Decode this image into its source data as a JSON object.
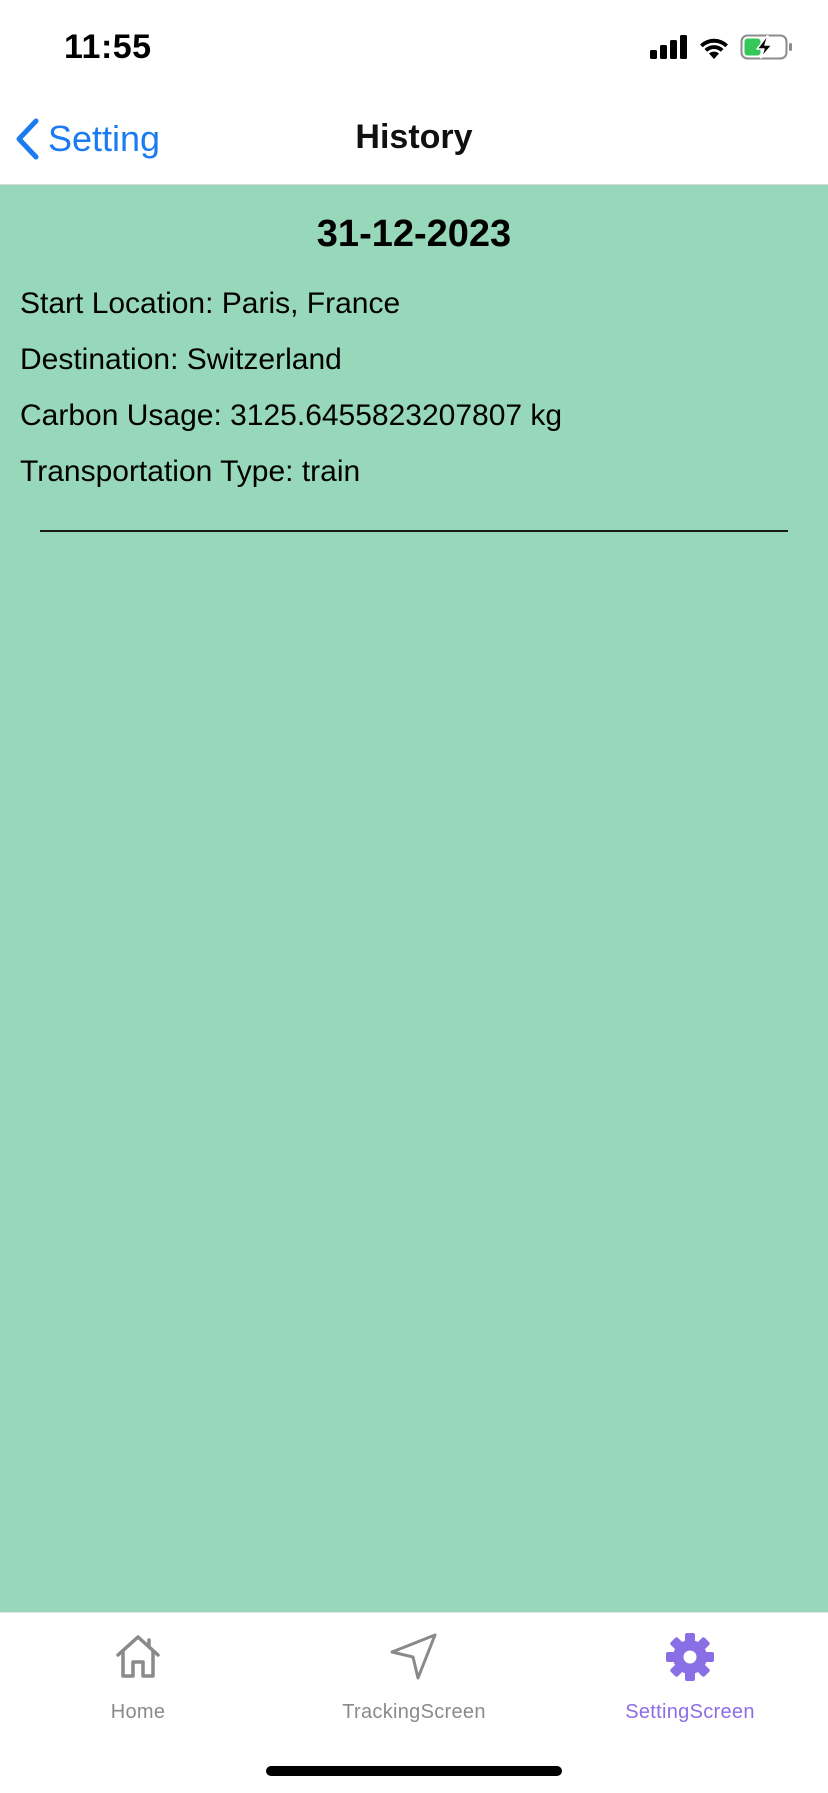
{
  "status_bar": {
    "time": "11:55",
    "icons": [
      "signal-icon",
      "wifi-icon",
      "battery-charging-icon"
    ],
    "battery_color": "#34c759"
  },
  "nav": {
    "back_label": "Setting",
    "title": "History",
    "accent_color": "#1a7cf0"
  },
  "entry": {
    "date": "31-12-2023",
    "start_location": "Start Location: Paris, France",
    "destination": "Destination: Switzerland",
    "carbon_usage": "Carbon Usage: 3125.6455823207807 kg",
    "transportation_type": "Transportation Type: train"
  },
  "content_bg": "#96d8b9",
  "tabs": [
    {
      "label": "Home",
      "icon": "home-icon",
      "active": false
    },
    {
      "label": "TrackingScreen",
      "icon": "navigation-arrow-icon",
      "active": false
    },
    {
      "label": "SettingScreen",
      "icon": "gear-icon",
      "active": true
    }
  ],
  "active_tab_color": "#8a6ee6"
}
